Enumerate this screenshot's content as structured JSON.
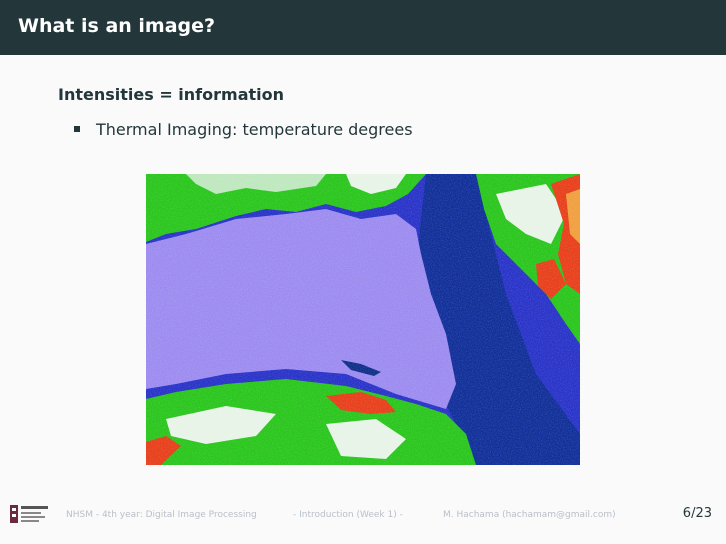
{
  "slide": {
    "title": "What is an image?",
    "heading": "Intensities = information",
    "bullets": [
      "Thermal Imaging: temperature degrees"
    ]
  },
  "image": {
    "name": "thermal-image",
    "colors": {
      "ocean_light": "#9d8cf0",
      "ocean_dark": "#2a34c8",
      "deep_channel": "#10308a",
      "land_green": "#2bc61e",
      "land_white": "#e8f4e8",
      "hot_red": "#e8401c",
      "hot_orange": "#f0a040"
    }
  },
  "footer": {
    "course": "NHSM - 4th year: Digital Image Processing",
    "section": "- Introduction (Week 1) -",
    "author": "M. Hachama (hachamam@gmail.com)",
    "page": "6/23"
  },
  "theme": {
    "titlebar_bg": "#23373b",
    "text": "#23373b",
    "footer_text": "#b8c0c8"
  }
}
